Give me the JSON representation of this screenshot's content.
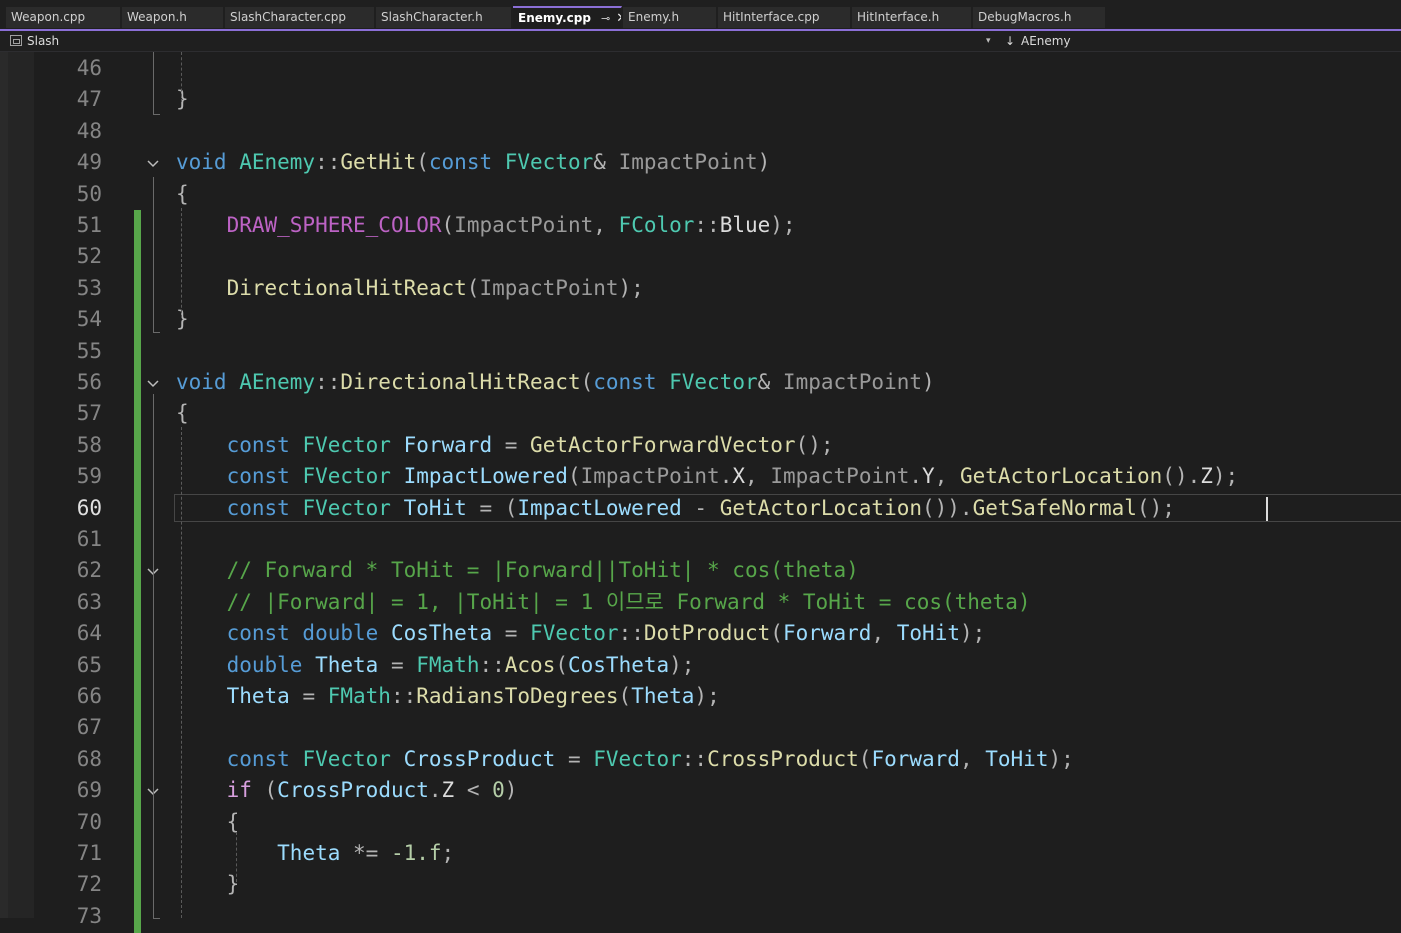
{
  "tabs": [
    {
      "label": "Weapon.cpp",
      "active": false
    },
    {
      "label": "Weapon.h",
      "active": false
    },
    {
      "label": "SlashCharacter.cpp",
      "active": false
    },
    {
      "label": "SlashCharacter.h",
      "active": false
    },
    {
      "label": "Enemy.cpp",
      "active": true
    },
    {
      "label": "Enemy.h",
      "active": false
    },
    {
      "label": "HitInterface.cpp",
      "active": false
    },
    {
      "label": "HitInterface.h",
      "active": false
    },
    {
      "label": "DebugMacros.h",
      "active": false
    }
  ],
  "tab_pin_icon": "⊸",
  "tab_close_icon": "✕",
  "navbar": {
    "project": "Slash",
    "dropdown_icon": "▾",
    "member_icon": "↓",
    "member": "AEnemy"
  },
  "editor": {
    "current_line": 60,
    "lines": [
      {
        "n": "46",
        "tokens": []
      },
      {
        "n": "47",
        "tokens": [
          {
            "c": "pu",
            "t": "}"
          }
        ]
      },
      {
        "n": "48",
        "tokens": []
      },
      {
        "n": "49",
        "fold": true,
        "tokens": [
          {
            "c": "kw",
            "t": "void "
          },
          {
            "c": "ty",
            "t": "AEnemy"
          },
          {
            "c": "pu",
            "t": "::"
          },
          {
            "c": "fn",
            "t": "GetHit"
          },
          {
            "c": "pu",
            "t": "("
          },
          {
            "c": "kw",
            "t": "const "
          },
          {
            "c": "ty",
            "t": "FVector"
          },
          {
            "c": "pu",
            "t": "& "
          },
          {
            "c": "pa",
            "t": "ImpactPoint"
          },
          {
            "c": "pu",
            "t": ")"
          }
        ]
      },
      {
        "n": "50",
        "tokens": [
          {
            "c": "pu",
            "t": "{"
          }
        ]
      },
      {
        "n": "51",
        "changed": true,
        "tokens": [
          {
            "c": "",
            "t": "    "
          },
          {
            "c": "mac",
            "t": "DRAW_SPHERE_COLOR"
          },
          {
            "c": "pu",
            "t": "("
          },
          {
            "c": "pa",
            "t": "ImpactPoint"
          },
          {
            "c": "pu",
            "t": ", "
          },
          {
            "c": "ty",
            "t": "FColor"
          },
          {
            "c": "pu",
            "t": "::"
          },
          {
            "c": "",
            "t": "Blue"
          },
          {
            "c": "pu",
            "t": ");"
          }
        ]
      },
      {
        "n": "52",
        "changed": true,
        "tokens": []
      },
      {
        "n": "53",
        "changed": true,
        "tokens": [
          {
            "c": "",
            "t": "    "
          },
          {
            "c": "fn",
            "t": "DirectionalHitReact"
          },
          {
            "c": "pu",
            "t": "("
          },
          {
            "c": "pa",
            "t": "ImpactPoint"
          },
          {
            "c": "pu",
            "t": ");"
          }
        ]
      },
      {
        "n": "54",
        "changed": true,
        "tokens": [
          {
            "c": "pu",
            "t": "}"
          }
        ]
      },
      {
        "n": "55",
        "changed": true,
        "tokens": []
      },
      {
        "n": "56",
        "changed": true,
        "fold": true,
        "tokens": [
          {
            "c": "kw",
            "t": "void "
          },
          {
            "c": "ty",
            "t": "AEnemy"
          },
          {
            "c": "pu",
            "t": "::"
          },
          {
            "c": "fn",
            "t": "DirectionalHitReact"
          },
          {
            "c": "pu",
            "t": "("
          },
          {
            "c": "kw",
            "t": "const "
          },
          {
            "c": "ty",
            "t": "FVector"
          },
          {
            "c": "pu",
            "t": "& "
          },
          {
            "c": "pa",
            "t": "ImpactPoint"
          },
          {
            "c": "pu",
            "t": ")"
          }
        ]
      },
      {
        "n": "57",
        "changed": true,
        "tokens": [
          {
            "c": "pu",
            "t": "{"
          }
        ]
      },
      {
        "n": "58",
        "changed": true,
        "tokens": [
          {
            "c": "",
            "t": "    "
          },
          {
            "c": "kw",
            "t": "const "
          },
          {
            "c": "ty",
            "t": "FVector "
          },
          {
            "c": "va",
            "t": "Forward"
          },
          {
            "c": "pu",
            "t": " = "
          },
          {
            "c": "fn",
            "t": "GetActorForwardVector"
          },
          {
            "c": "pu",
            "t": "();"
          }
        ]
      },
      {
        "n": "59",
        "changed": true,
        "tokens": [
          {
            "c": "",
            "t": "    "
          },
          {
            "c": "kw",
            "t": "const "
          },
          {
            "c": "ty",
            "t": "FVector "
          },
          {
            "c": "va",
            "t": "ImpactLowered"
          },
          {
            "c": "pu",
            "t": "("
          },
          {
            "c": "pa",
            "t": "ImpactPoint"
          },
          {
            "c": "pu",
            "t": "."
          },
          {
            "c": "",
            "t": "X"
          },
          {
            "c": "pu",
            "t": ", "
          },
          {
            "c": "pa",
            "t": "ImpactPoint"
          },
          {
            "c": "pu",
            "t": "."
          },
          {
            "c": "",
            "t": "Y"
          },
          {
            "c": "pu",
            "t": ", "
          },
          {
            "c": "fn",
            "t": "GetActorLocation"
          },
          {
            "c": "pu",
            "t": "()."
          },
          {
            "c": "",
            "t": "Z"
          },
          {
            "c": "pu",
            "t": ");"
          }
        ]
      },
      {
        "n": "60",
        "changed": true,
        "current": true,
        "tokens": [
          {
            "c": "",
            "t": "    "
          },
          {
            "c": "kw",
            "t": "const "
          },
          {
            "c": "ty",
            "t": "FVector "
          },
          {
            "c": "va",
            "t": "ToHit"
          },
          {
            "c": "pu",
            "t": " = ("
          },
          {
            "c": "va",
            "t": "ImpactLowered"
          },
          {
            "c": "pu",
            "t": " - "
          },
          {
            "c": "fn",
            "t": "GetActorLocation"
          },
          {
            "c": "pu",
            "t": "())."
          },
          {
            "c": "fn",
            "t": "GetSafeNormal"
          },
          {
            "c": "pu",
            "t": "();"
          }
        ]
      },
      {
        "n": "61",
        "changed": true,
        "tokens": []
      },
      {
        "n": "62",
        "changed": true,
        "fold": true,
        "tokens": [
          {
            "c": "",
            "t": "    "
          },
          {
            "c": "cm",
            "t": "// Forward * ToHit = |Forward||ToHit| * cos(theta)"
          }
        ]
      },
      {
        "n": "63",
        "changed": true,
        "tokens": [
          {
            "c": "",
            "t": "    "
          },
          {
            "c": "cm",
            "t": "// |Forward| = 1, |ToHit| = 1 이므로 Forward * ToHit = cos(theta)"
          }
        ]
      },
      {
        "n": "64",
        "changed": true,
        "tokens": [
          {
            "c": "",
            "t": "    "
          },
          {
            "c": "kw",
            "t": "const double "
          },
          {
            "c": "va",
            "t": "CosTheta"
          },
          {
            "c": "pu",
            "t": " = "
          },
          {
            "c": "ty",
            "t": "FVector"
          },
          {
            "c": "pu",
            "t": "::"
          },
          {
            "c": "fn",
            "t": "DotProduct"
          },
          {
            "c": "pu",
            "t": "("
          },
          {
            "c": "va",
            "t": "Forward"
          },
          {
            "c": "pu",
            "t": ", "
          },
          {
            "c": "va",
            "t": "ToHit"
          },
          {
            "c": "pu",
            "t": ");"
          }
        ]
      },
      {
        "n": "65",
        "changed": true,
        "tokens": [
          {
            "c": "",
            "t": "    "
          },
          {
            "c": "kw",
            "t": "double "
          },
          {
            "c": "va",
            "t": "Theta"
          },
          {
            "c": "pu",
            "t": " = "
          },
          {
            "c": "ty",
            "t": "FMath"
          },
          {
            "c": "pu",
            "t": "::"
          },
          {
            "c": "fn",
            "t": "Acos"
          },
          {
            "c": "pu",
            "t": "("
          },
          {
            "c": "va",
            "t": "CosTheta"
          },
          {
            "c": "pu",
            "t": ");"
          }
        ]
      },
      {
        "n": "66",
        "changed": true,
        "tokens": [
          {
            "c": "",
            "t": "    "
          },
          {
            "c": "va",
            "t": "Theta"
          },
          {
            "c": "pu",
            "t": " = "
          },
          {
            "c": "ty",
            "t": "FMath"
          },
          {
            "c": "pu",
            "t": "::"
          },
          {
            "c": "fn",
            "t": "RadiansToDegrees"
          },
          {
            "c": "pu",
            "t": "("
          },
          {
            "c": "va",
            "t": "Theta"
          },
          {
            "c": "pu",
            "t": ");"
          }
        ]
      },
      {
        "n": "67",
        "changed": true,
        "tokens": []
      },
      {
        "n": "68",
        "changed": true,
        "tokens": [
          {
            "c": "",
            "t": "    "
          },
          {
            "c": "kw",
            "t": "const "
          },
          {
            "c": "ty",
            "t": "FVector "
          },
          {
            "c": "va",
            "t": "CrossProduct"
          },
          {
            "c": "pu",
            "t": " = "
          },
          {
            "c": "ty",
            "t": "FVector"
          },
          {
            "c": "pu",
            "t": "::"
          },
          {
            "c": "fn",
            "t": "CrossProduct"
          },
          {
            "c": "pu",
            "t": "("
          },
          {
            "c": "va",
            "t": "Forward"
          },
          {
            "c": "pu",
            "t": ", "
          },
          {
            "c": "va",
            "t": "ToHit"
          },
          {
            "c": "pu",
            "t": ");"
          }
        ]
      },
      {
        "n": "69",
        "changed": true,
        "fold": true,
        "tokens": [
          {
            "c": "",
            "t": "    "
          },
          {
            "c": "ctl",
            "t": "if "
          },
          {
            "c": "pu",
            "t": "("
          },
          {
            "c": "va",
            "t": "CrossProduct"
          },
          {
            "c": "pu",
            "t": "."
          },
          {
            "c": "",
            "t": "Z"
          },
          {
            "c": "pu",
            "t": " < "
          },
          {
            "c": "nu",
            "t": "0"
          },
          {
            "c": "pu",
            "t": ")"
          }
        ]
      },
      {
        "n": "70",
        "changed": true,
        "tokens": [
          {
            "c": "",
            "t": "    "
          },
          {
            "c": "pu",
            "t": "{"
          }
        ]
      },
      {
        "n": "71",
        "changed": true,
        "tokens": [
          {
            "c": "",
            "t": "        "
          },
          {
            "c": "va",
            "t": "Theta"
          },
          {
            "c": "pu",
            "t": " *= "
          },
          {
            "c": "nu",
            "t": "-1.f"
          },
          {
            "c": "pu",
            "t": ";"
          }
        ]
      },
      {
        "n": "72",
        "changed": true,
        "tokens": [
          {
            "c": "",
            "t": "    "
          },
          {
            "c": "pu",
            "t": "}"
          }
        ]
      },
      {
        "n": "73",
        "changed": true,
        "tokens": []
      }
    ]
  }
}
